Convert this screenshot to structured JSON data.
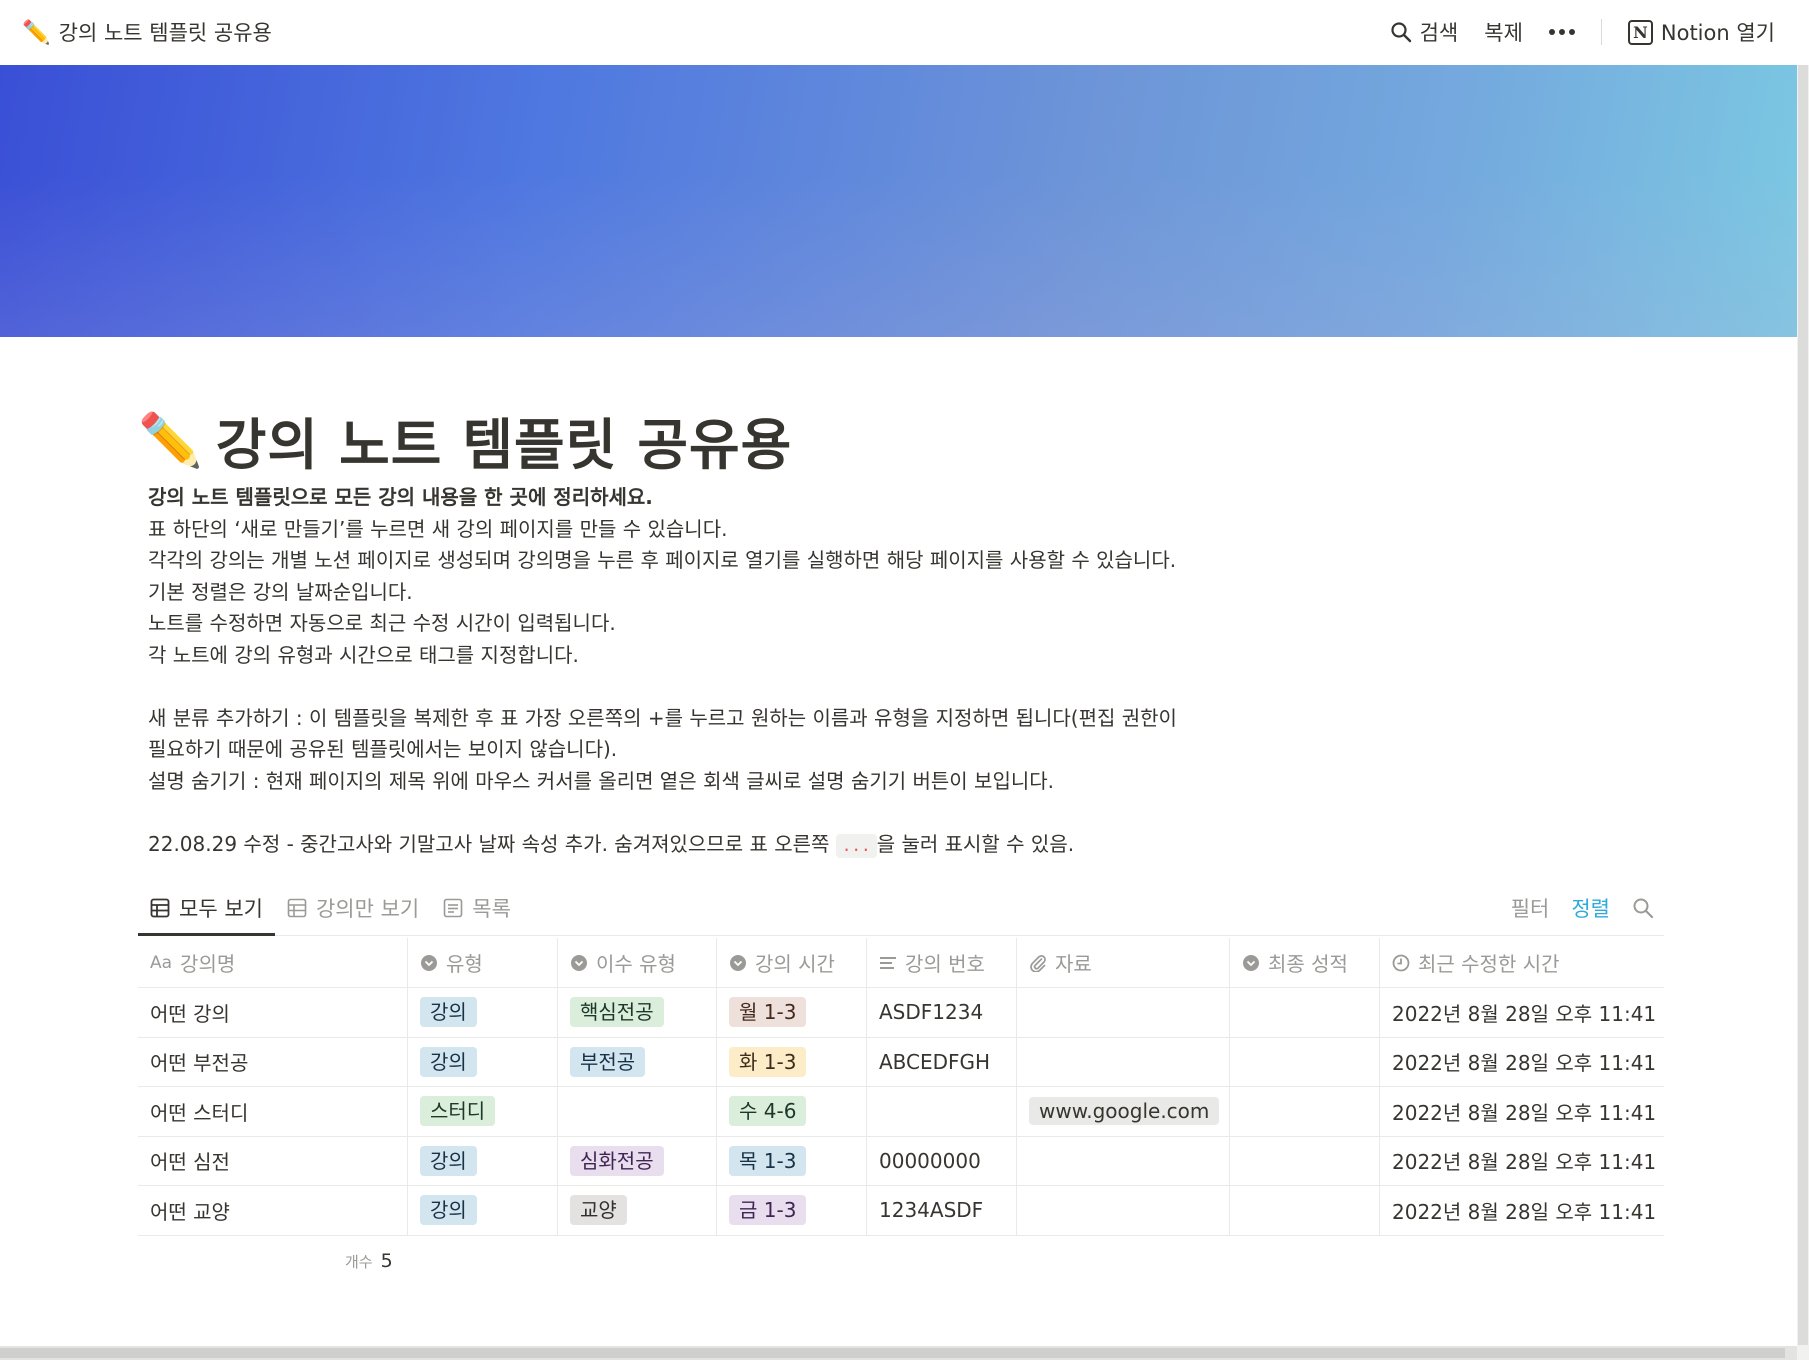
{
  "topbar": {
    "emoji": "✏️",
    "breadcrumb": "강의 노트 템플릿 공유용",
    "search_label": "검색",
    "duplicate_label": "복제",
    "open_label": "Notion 열기"
  },
  "page": {
    "emoji": "✏️",
    "title": "강의 노트 템플릿 공유용",
    "desc_bold": "강의 노트 템플릿으로 모든 강의 내용을 한 곳에 정리하세요.",
    "desc_lines": [
      "표 하단의 ‘새로 만들기’를 누르면 새 강의 페이지를 만들 수 있습니다.",
      "각각의 강의는 개별 노션 페이지로 생성되며 강의명을 누른 후 페이지로 열기를 실행하면 해당 페이지를 사용할 수 있습니다.",
      "기본 정렬은 강의 날짜순입니다.",
      "노트를 수정하면 자동으로 최근 수정 시간이 입력됩니다.",
      "각 노트에 강의 유형과 시간으로 태그를 지정합니다."
    ],
    "add_category_line1": "새 분류 추가하기 : 이 템플릿을 복제한 후 표 가장 오른쪽의 +를 누르고 원하는 이름과 유형을 지정하면 됩니다(편집 권한이",
    "add_category_line2": "필요하기 때문에 공유된 템플릿에서는 보이지 않습니다).",
    "hide_desc_line": "설명 숨기기 : 현재 페이지의 제목 위에 마우스 커서를 올리면 옅은 회색 글씨로 설명 숨기기 버튼이 보입니다.",
    "update_before": "22.08.29 수정 - 중간고사와 기말고사 날짜 속성 추가. 숨겨져있으므로 표 오른쪽 ",
    "update_code": "...",
    "update_after": "을 눌러 표시할 수 있음."
  },
  "views": {
    "tabs": [
      "모두 보기",
      "강의만 보기",
      "목록"
    ],
    "filter_label": "필터",
    "sort_label": "정렬"
  },
  "table": {
    "columns": [
      "강의명",
      "유형",
      "이수 유형",
      "강의 시간",
      "강의 번호",
      "자료",
      "최종 성적",
      "최근 수정한 시간"
    ],
    "rows": [
      {
        "name": "어떤 강의",
        "type": "강의",
        "credit": "핵심전공",
        "time": "월 1-3",
        "code": "ASDF1234",
        "material": "",
        "grade": "",
        "modified": "2022년 8월 28일 오후 11:41"
      },
      {
        "name": "어떤 부전공",
        "type": "강의",
        "credit": "부전공",
        "time": "화 1-3",
        "code": "ABCEDFGH",
        "material": "",
        "grade": "",
        "modified": "2022년 8월 28일 오후 11:41"
      },
      {
        "name": "어떤 스터디",
        "type": "스터디",
        "credit": "",
        "time": "수 4-6",
        "code": "",
        "material": "www.google.com",
        "grade": "",
        "modified": "2022년 8월 28일 오후 11:41"
      },
      {
        "name": "어떤 심전",
        "type": "강의",
        "credit": "심화전공",
        "time": "목 1-3",
        "code": "00000000",
        "material": "",
        "grade": "",
        "modified": "2022년 8월 28일 오후 11:41"
      },
      {
        "name": "어떤 교양",
        "type": "강의",
        "credit": "교양",
        "time": "금 1-3",
        "code": "1234ASDF",
        "material": "",
        "grade": "",
        "modified": "2022년 8월 28일 오후 11:41"
      }
    ],
    "count_label": "개수",
    "count_value": "5"
  },
  "tag_colors": {
    "강의": {
      "bg": "#d3e5ef",
      "fg": "#183347"
    },
    "스터디": {
      "bg": "#dbeddb",
      "fg": "#1c3829"
    },
    "핵심전공": {
      "bg": "#dbeddb",
      "fg": "#1c3829"
    },
    "부전공": {
      "bg": "#d3e5ef",
      "fg": "#183347"
    },
    "심화전공": {
      "bg": "#e8deee",
      "fg": "#412454"
    },
    "교양": {
      "bg": "#e3e2e0",
      "fg": "#32302c"
    },
    "월 1-3": {
      "bg": "#eee0da",
      "fg": "#442a1e"
    },
    "화 1-3": {
      "bg": "#fdecc8",
      "fg": "#402c1b"
    },
    "수 4-6": {
      "bg": "#dbeddb",
      "fg": "#1c3829"
    },
    "목 1-3": {
      "bg": "#d3e5ef",
      "fg": "#183347"
    },
    "금 1-3": {
      "bg": "#e8deee",
      "fg": "#412454"
    }
  },
  "icons": {
    "search": "search-icon",
    "more": "more-dots-icon",
    "notion": "notion-logo-icon",
    "table_view": "table-icon",
    "list_view": "page-icon",
    "title_prop": "text-aa-icon",
    "select_prop": "select-icon",
    "text_prop": "text-lines-icon",
    "file_prop": "paperclip-icon",
    "time_prop": "clock-icon"
  }
}
